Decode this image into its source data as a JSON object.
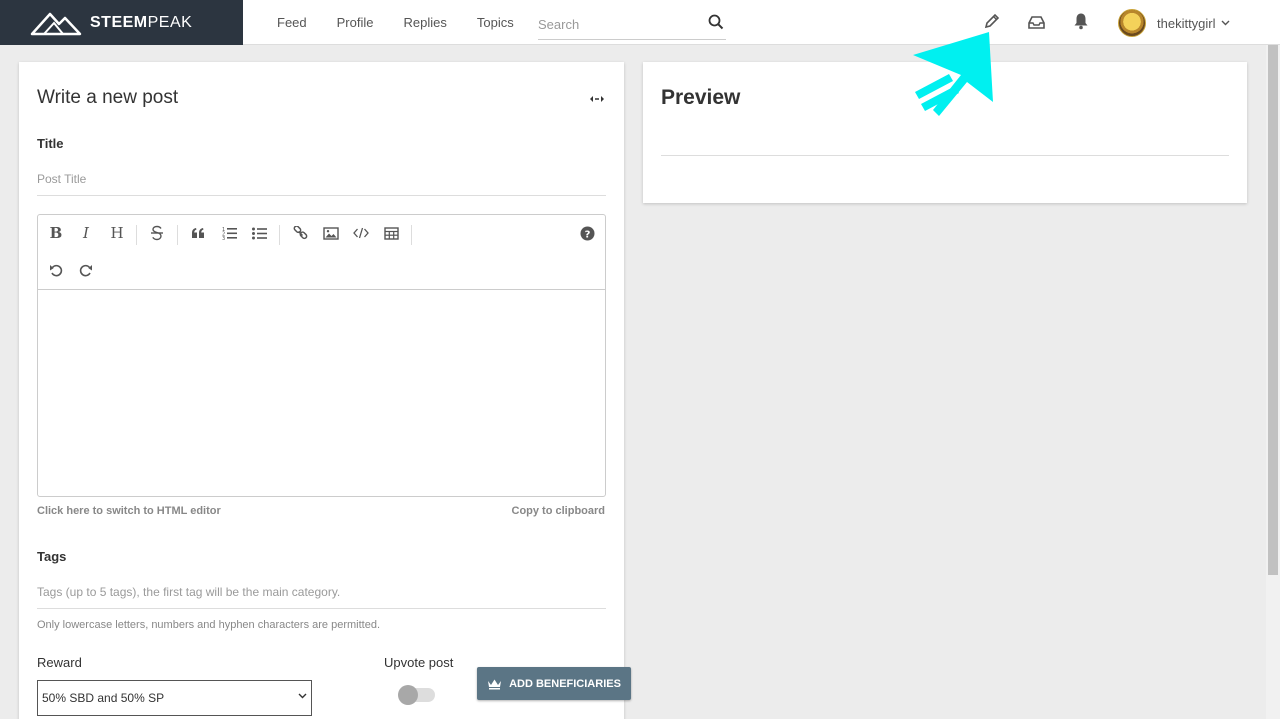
{
  "brand": {
    "name_bold": "STEEM",
    "name_light": "PEAK"
  },
  "nav": {
    "items": [
      "Feed",
      "Profile",
      "Replies",
      "Topics"
    ]
  },
  "search": {
    "placeholder": "Search"
  },
  "user": {
    "name": "thekittygirl"
  },
  "editor": {
    "title": "Write a new post",
    "title_label": "Title",
    "title_placeholder": "Post Title",
    "html_switch": "Click here to switch to HTML editor",
    "copy": "Copy to clipboard",
    "tags_label": "Tags",
    "tags_placeholder": "Tags (up to 5 tags), the first tag will be the main category.",
    "tags_hint": "Only lowercase letters, numbers and hyphen characters are permitted.",
    "reward_label": "Reward",
    "reward_value": "50% SBD and 50% SP",
    "upvote_label": "Upvote post",
    "beneficiaries_button": "ADD BENEFICIARIES",
    "toolbar": {
      "bold": "B",
      "italic": "I",
      "heading": "H"
    }
  },
  "preview": {
    "title": "Preview"
  },
  "colors": {
    "header_dark": "#2c3540",
    "button": "#5b7585",
    "highlight_arrow": "#00f0f0"
  }
}
